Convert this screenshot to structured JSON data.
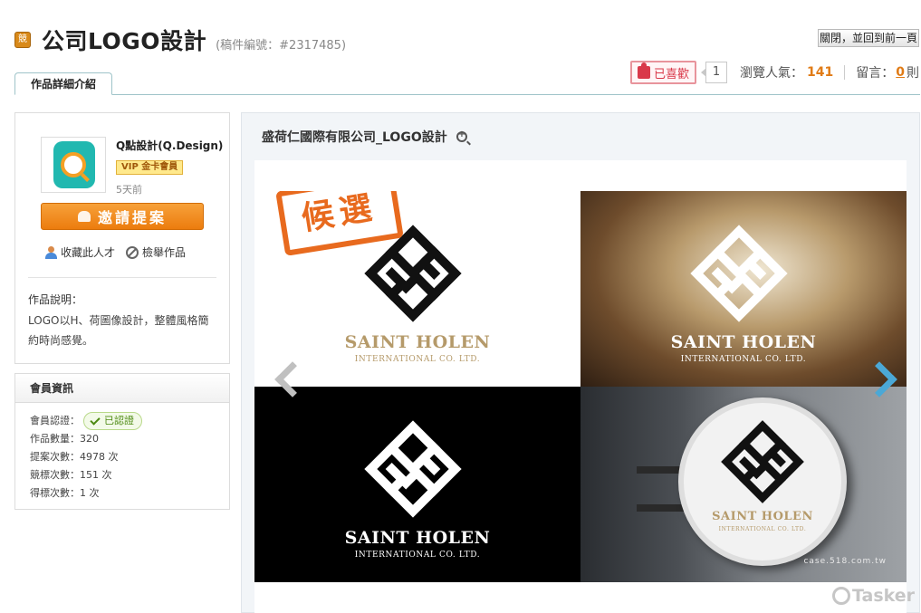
{
  "header": {
    "badge_label": "競",
    "title": "公司LOGO設計",
    "case_no": "(稿件編號：#2317485)",
    "close_button": "關閉，並回到前一頁"
  },
  "stats": {
    "like_label": "已喜歡",
    "like_count": "1",
    "views_label": "瀏覽人氣：",
    "views_value": "141",
    "comments_label": "留言：",
    "comments_value": "0",
    "comments_unit": "則"
  },
  "tabs": [
    {
      "label": "作品詳細介紹"
    }
  ],
  "profile": {
    "name": "Q點設計(Q.Design)",
    "vip_badge": "VIP 金卡會員",
    "posted": "5天前",
    "invite_button": "邀請提案",
    "collect_link": "收藏此人才",
    "report_link": "檢舉作品",
    "desc_title": "作品說明：",
    "desc_text": "LOGO以H、荷圖像設計，整體風格簡約時尚感覺。"
  },
  "member_info": {
    "title": "會員資訊",
    "cert_label": "會員認證：",
    "cert_value": "已認證",
    "rows": [
      "作品數量：320",
      "提案次數：4978 次",
      "競標次數：151 次",
      "得標次數：1 次"
    ]
  },
  "work": {
    "title": "盛荷仁國際有限公司_LOGO設計",
    "stamp": "候選",
    "brand_name": "SAINT HOLEN",
    "brand_sub": "INTERNATIONAL CO. LTD.",
    "site_watermark": "case.518.com.tw",
    "tasker_watermark": "Tasker"
  },
  "colors": {
    "accent_orange": "#ec7c0e",
    "brand_gold": "#b59a6a",
    "like_red": "#d9394a",
    "next_arrow_blue": "#4ba8d6"
  }
}
